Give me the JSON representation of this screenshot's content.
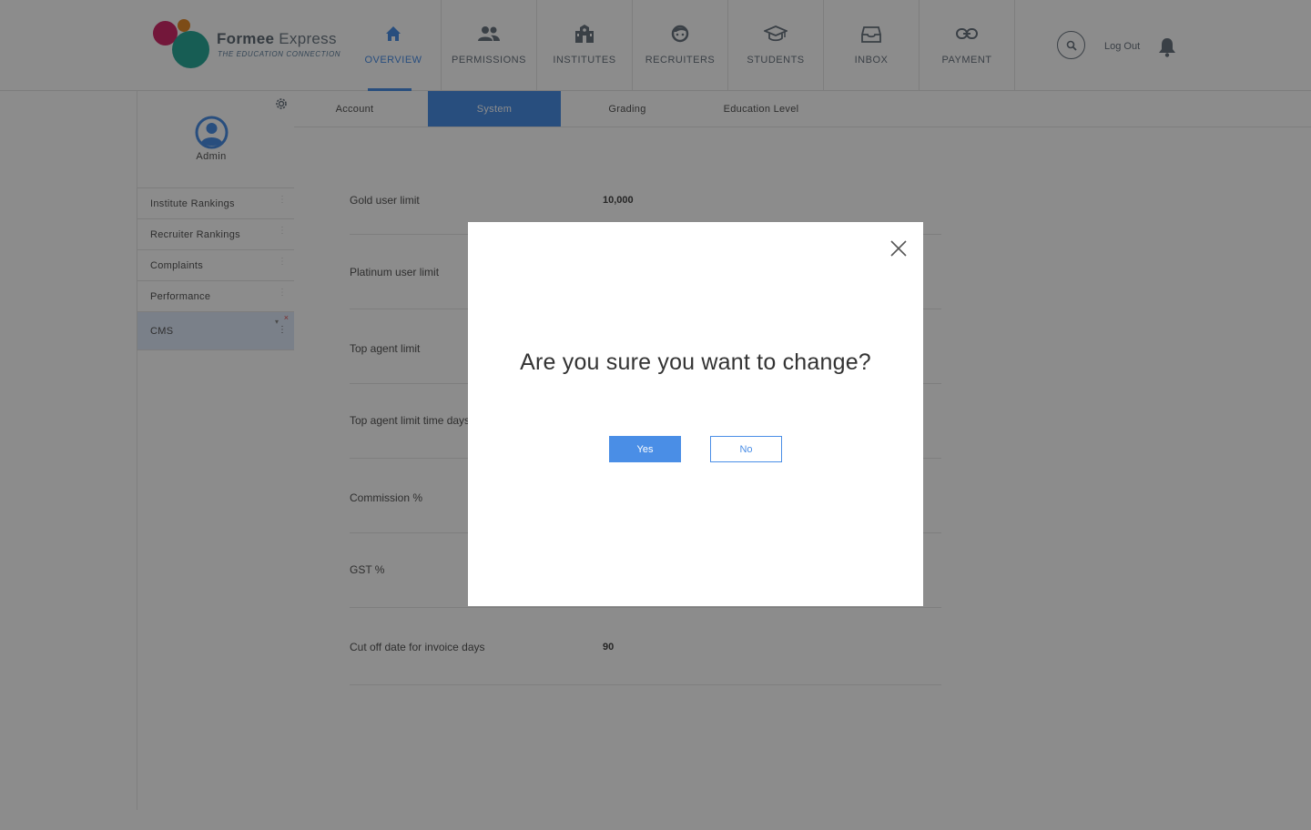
{
  "brand": {
    "name_bold": "Formee",
    "name_light": "Express",
    "tagline": "THE EDUCATION CONNECTION"
  },
  "nav": {
    "items": [
      {
        "label": "OVERVIEW",
        "icon": "home-icon",
        "active": true
      },
      {
        "label": "PERMISSIONS",
        "icon": "users-icon",
        "active": false
      },
      {
        "label": "INSTITUTES",
        "icon": "institute-icon",
        "active": false
      },
      {
        "label": "RECRUITERS",
        "icon": "recruiter-icon",
        "active": false
      },
      {
        "label": "STUDENTS",
        "icon": "graduation-cap-icon",
        "active": false
      },
      {
        "label": "INBOX",
        "icon": "inbox-icon",
        "active": false
      },
      {
        "label": "PAYMENT",
        "icon": "link-icon",
        "active": false
      }
    ],
    "logout": "Log Out"
  },
  "sidebar": {
    "user": "Admin",
    "items": [
      {
        "label": "Institute Rankings"
      },
      {
        "label": "Recruiter Rankings"
      },
      {
        "label": "Complaints"
      },
      {
        "label": "Performance"
      },
      {
        "label": "CMS",
        "active": true
      }
    ]
  },
  "tabs": [
    {
      "label": "Account"
    },
    {
      "label": "System",
      "active": true
    },
    {
      "label": "Grading"
    },
    {
      "label": "Education Level"
    }
  ],
  "settings": [
    {
      "label": "Gold user limit",
      "value": "10,000"
    },
    {
      "label": "Platinum user limit",
      "value": ""
    },
    {
      "label": "Top agent limit",
      "value": ""
    },
    {
      "label": "Top agent limit time days",
      "value": ""
    },
    {
      "label": "Commission %",
      "value": ""
    },
    {
      "label": "GST %",
      "value": ""
    },
    {
      "label": "Cut off date for invoice days",
      "value": "90"
    }
  ],
  "modal": {
    "question": "Are you sure you want to change?",
    "yes": "Yes",
    "no": "No"
  },
  "colors": {
    "accent": "#4a8ee6",
    "overlay": "rgba(0,0,0,0.45)"
  }
}
